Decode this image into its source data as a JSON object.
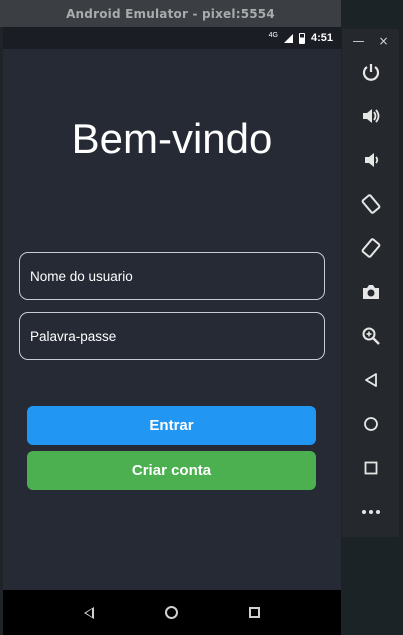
{
  "window": {
    "title": "Android Emulator - pixel:5554"
  },
  "status_bar": {
    "network": "4G",
    "time": "4:51"
  },
  "app": {
    "heading": "Bem-vindo",
    "username_placeholder": "Nome do usuario",
    "password_placeholder": "Palavra-passe",
    "login_label": "Entrar",
    "signup_label": "Criar conta"
  },
  "colors": {
    "login_button": "#2196f3",
    "signup_button": "#4caf50",
    "screen_background": "#262a35"
  },
  "toolbar": {
    "minimize": "—",
    "close": "×",
    "icons": [
      "power-icon",
      "volume-up-icon",
      "volume-down-icon",
      "rotate-left-icon",
      "rotate-right-icon",
      "camera-icon",
      "zoom-icon",
      "back-icon",
      "home-icon",
      "overview-icon",
      "more-icon"
    ]
  }
}
